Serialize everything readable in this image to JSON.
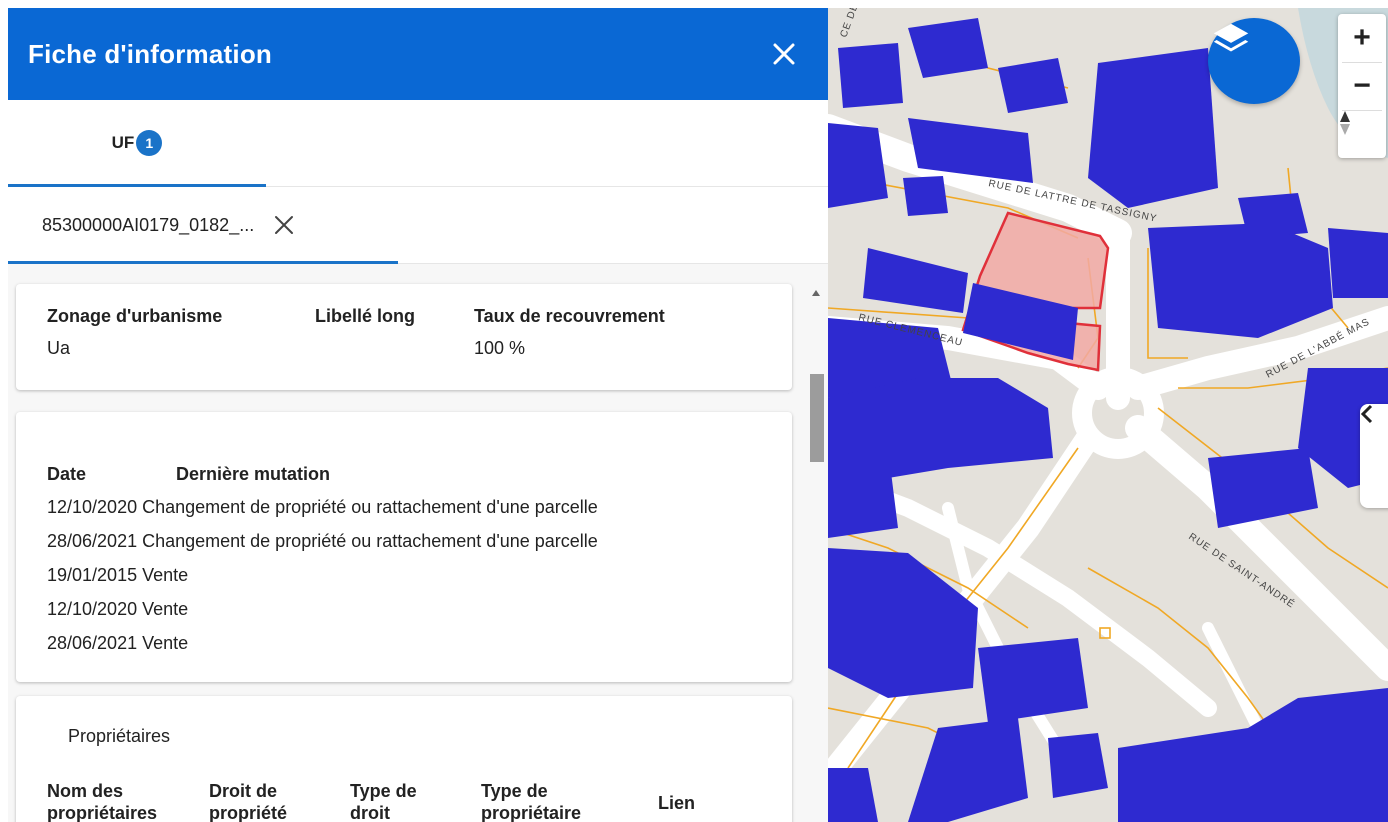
{
  "colors": {
    "header_blue": "#0a68d4",
    "accent_blue": "#1a73c8",
    "building": "#2e2ad0",
    "building_top": "#3a37e6",
    "road_orange": "#f0a825",
    "parcel_red": "#e0303a",
    "parcel_fill": "#f2a9a5",
    "map_ground": "#e4e1db",
    "water": "#c8d9dd"
  },
  "panel": {
    "title": "Fiche d'information",
    "close_icon": "close-icon",
    "tab": {
      "label": "UF",
      "badge": "1"
    },
    "subtab": {
      "label": "85300000AI0179_0182_...",
      "close_icon": "close-icon"
    }
  },
  "zonage": {
    "headers": [
      "Zonage d'urbanisme",
      "Libellé long",
      "Taux de recouvrement"
    ],
    "values": [
      "Ua",
      "",
      "100 %"
    ]
  },
  "mutations": {
    "headers": [
      "Date",
      "Dernière mutation"
    ],
    "rows": [
      "12/10/2020 Changement de propriété ou rattachement d'une parcelle",
      "28/06/2021 Changement de propriété ou rattachement d'une parcelle",
      "19/01/2015 Vente",
      "12/10/2020 Vente",
      "28/06/2021 Vente"
    ]
  },
  "proprietaires": {
    "title": "Propriétaires",
    "headers": [
      [
        "Nom des",
        "propriétaires"
      ],
      [
        "Droit de",
        "propriété"
      ],
      [
        "Type de",
        "droit"
      ],
      [
        "Type de",
        "propriétaire"
      ],
      [
        "Lien"
      ]
    ]
  },
  "map": {
    "layers_icon": "layers-icon",
    "zoom_in": "+",
    "zoom_out": "−",
    "compass_icon": "compass-icon",
    "toggle_icon": "chevron-left-icon",
    "street_labels": [
      "RUE DE LATTRE DE TASSIGNY",
      "RUE DE L'ABBÉ MAS",
      "RUE DE SAINT-ANDRÉ",
      "RUE CLEMENCEAU",
      "CE DE LA"
    ]
  }
}
